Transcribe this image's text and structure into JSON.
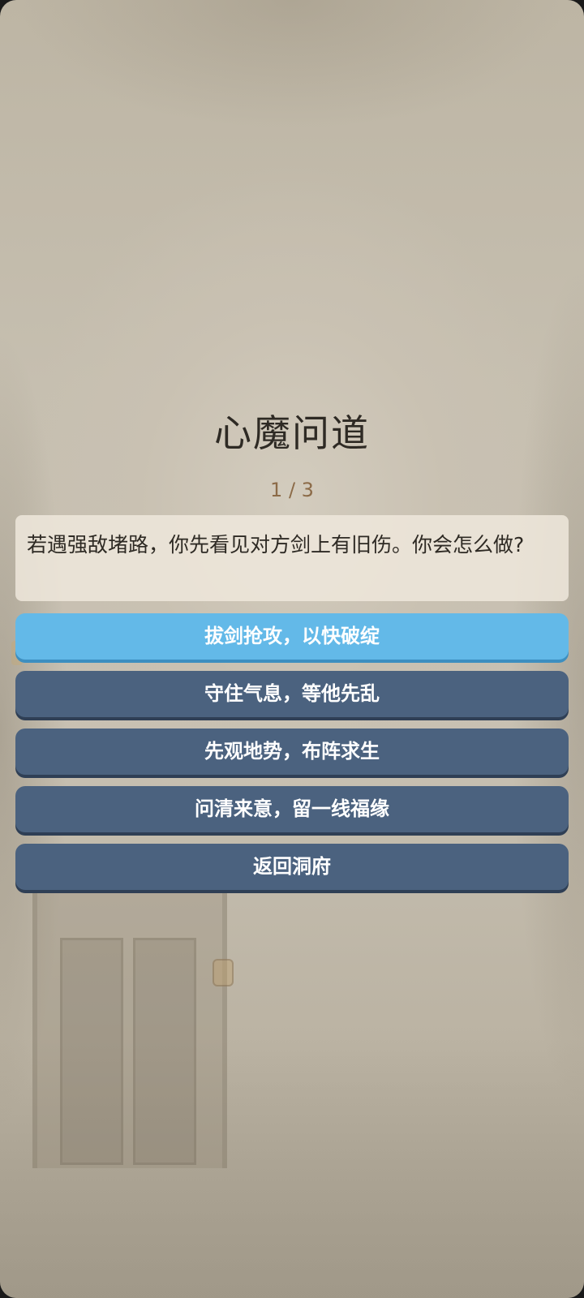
{
  "screen": {
    "title": "心魔问道",
    "progress": "1 / 3",
    "question": "若遇强敌堵路，你先看见对方剑上有旧伤。你会怎么做?"
  },
  "options": [
    {
      "label": "拔剑抢攻，以快破绽",
      "selected": true
    },
    {
      "label": "守住气息，等他先乱",
      "selected": false
    },
    {
      "label": "先观地势，布阵求生",
      "selected": false
    },
    {
      "label": "问清来意，留一线福缘",
      "selected": false
    }
  ],
  "back_button": {
    "label": "返回洞府"
  },
  "colors": {
    "option_default": "#4b627f",
    "option_selected": "#63b9e8",
    "progress_text": "#8c6b48"
  }
}
